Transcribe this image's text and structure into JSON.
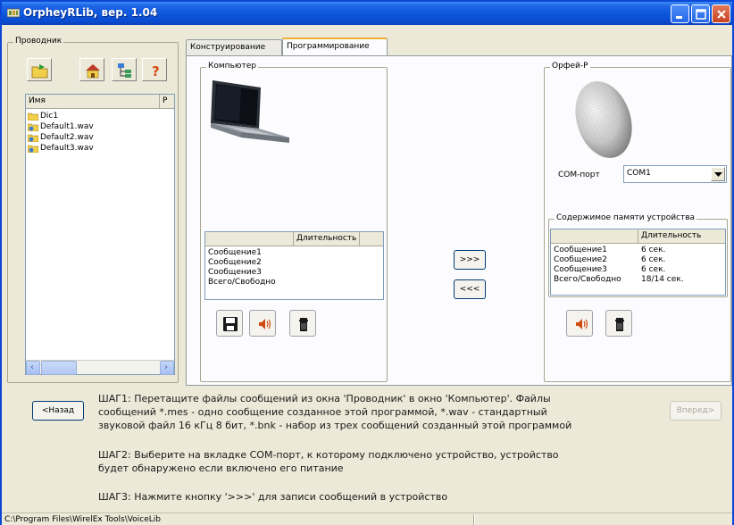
{
  "window": {
    "title": "OrpheyRLib, вер. 1.04"
  },
  "explorer": {
    "label": "Проводник",
    "columns": [
      "Имя",
      "Р"
    ],
    "files": [
      {
        "name": "Dic1",
        "icon": "folder-icon"
      },
      {
        "name": "Default1.wav",
        "icon": "sound-file-icon"
      },
      {
        "name": "Default2.wav",
        "icon": "sound-file-icon"
      },
      {
        "name": "Default3.wav",
        "icon": "sound-file-icon"
      }
    ]
  },
  "tabs": [
    {
      "label": "Конструирование",
      "active": false
    },
    {
      "label": "Программирование",
      "active": true
    }
  ],
  "computer": {
    "label": "Компьютер",
    "table_header": "Длительность",
    "rows": [
      {
        "name": "Сообщение1",
        "duration": ""
      },
      {
        "name": "Сообщение2",
        "duration": ""
      },
      {
        "name": "Сообщение3",
        "duration": ""
      },
      {
        "name": "Всего/Свободно",
        "duration": ""
      }
    ]
  },
  "transfer": {
    "write_label": ">>>",
    "read_label": "<<<"
  },
  "device": {
    "label": "Орфей-Р",
    "com_label": "COM-порт",
    "com_value": "COM1",
    "memory_label": "Содержимое памяти устройства",
    "table_header": "Длительность",
    "rows": [
      {
        "name": "Сообщение1",
        "duration": "6 сек."
      },
      {
        "name": "Сообщение2",
        "duration": "6 сек."
      },
      {
        "name": "Сообщение3",
        "duration": "6 сек."
      },
      {
        "name": "Всего/Свободно",
        "duration": "18/14 сек."
      }
    ]
  },
  "nav": {
    "back_label": "<Назад",
    "next_label": "Вперед>"
  },
  "instructions": {
    "step1_line1": "ШАГ1: Перетащите файлы сообщений из окна 'Проводник' в окно 'Компьютер'. Файлы",
    "step1_line2": "сообщений *.mes - одно сообщение созданное этой программой, *.wav - стандартный",
    "step1_line3": "звуковой файл 16 кГц 8 бит, *.bnk - набор из трех сообщений созданный этой программой",
    "step2_line1": "ШАГ2: Выберите на вкладке COM-порт, к которому подключено устройство, устройство",
    "step2_line2": "будет обнаружено если включено его питание",
    "step3_line1": "ШАГ3: Нажмите кнопку '>>>' для записи сообщений в устройство"
  },
  "status": {
    "path": "C:\\Program Files\\WirelEx Tools\\VoiceLib"
  }
}
